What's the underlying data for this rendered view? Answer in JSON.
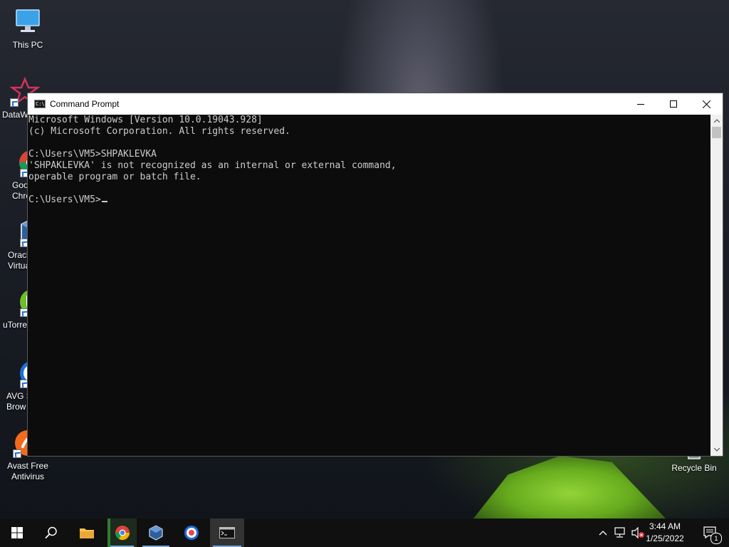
{
  "desktop": {
    "icons": [
      {
        "label": "This PC"
      },
      {
        "label": "DataW"
      },
      {
        "label": "Goo\nChro"
      },
      {
        "label": "Oracl\nVirtua"
      },
      {
        "label": "uTorren"
      },
      {
        "label": "AVG S\nBrow"
      },
      {
        "label": "Avast Free\nAntivirus"
      },
      {
        "label": "Recycle Bin"
      }
    ]
  },
  "window": {
    "title": "Command Prompt",
    "icon_text": "C:\\",
    "controls": [
      "minimize-icon",
      "maximize-icon",
      "close-icon"
    ]
  },
  "console": {
    "lines": [
      "Microsoft Windows [Version 10.0.19043.928]",
      "(c) Microsoft Corporation. All rights reserved.",
      "",
      "C:\\Users\\VM5>SHPAKLEVKA",
      "'SHPAKLEVKA' is not recognized as an internal or external command,",
      "operable program or batch file.",
      "",
      "C:\\Users\\VM5>"
    ]
  },
  "taskbar": {
    "apps": [
      "start-icon",
      "search-icon",
      "file-explorer-icon",
      "chrome-icon",
      "virtualbox-icon",
      "avg-browser-icon",
      "command-prompt-icon"
    ],
    "clock": {
      "time": "3:44 AM",
      "date": "1/25/2022"
    },
    "notification_count": "1"
  },
  "colors": {
    "console_bg": "#0c0c0c",
    "console_text": "#cccccc",
    "taskbar_bg": "#101010",
    "active_underline": "#7aa7d8"
  }
}
